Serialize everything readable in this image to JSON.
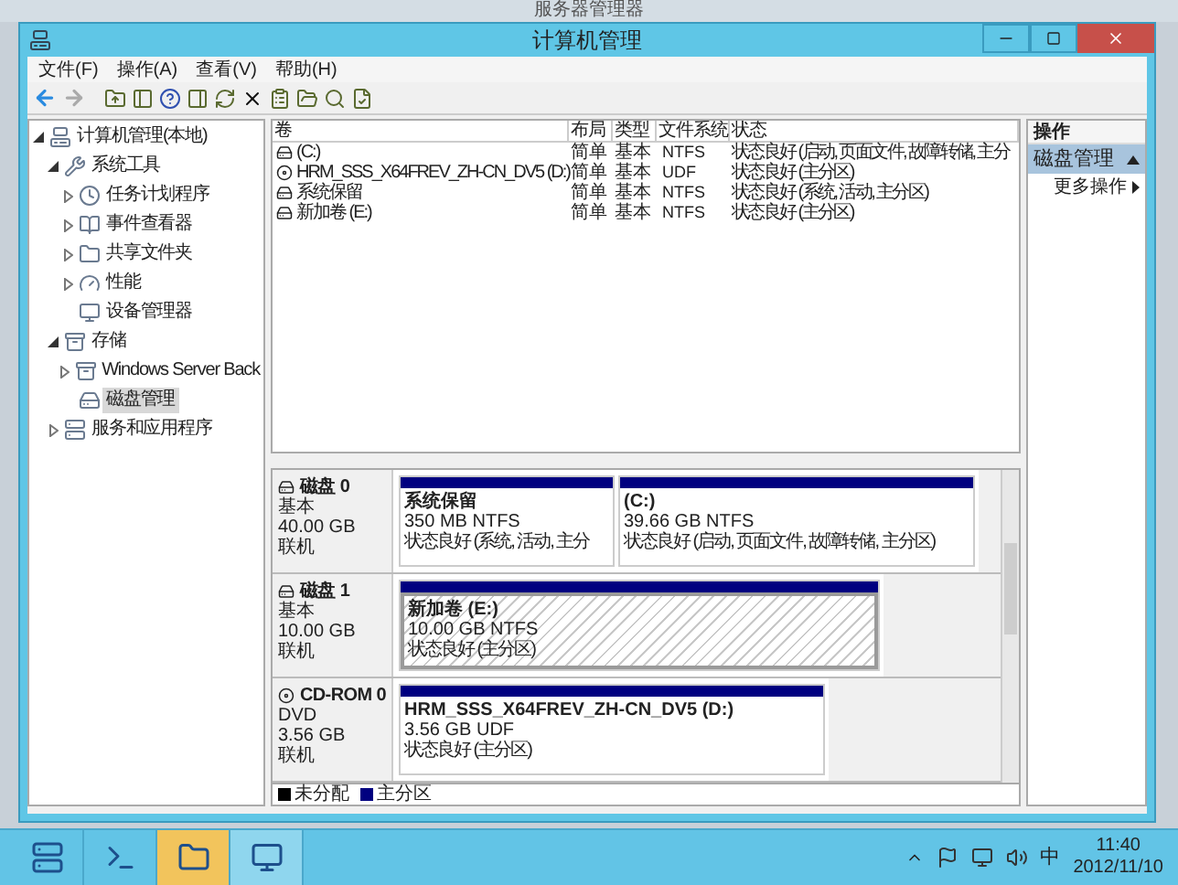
{
  "background_window": {
    "title": "服务器管理器"
  },
  "window": {
    "title": "计算机管理"
  },
  "menu": [
    {
      "label": "文件(F)"
    },
    {
      "label": "操作(A)"
    },
    {
      "label": "查看(V)"
    },
    {
      "label": "帮助(H)"
    }
  ],
  "toolbar": {
    "back_disabled": false,
    "forward_disabled": true
  },
  "tree": [
    {
      "label": "计算机管理(本地)",
      "expanded": true,
      "selected": false,
      "children": [
        {
          "label": "系统工具",
          "expanded": true,
          "selected": false,
          "children": [
            {
              "label": "任务计划程序",
              "expanded": false,
              "selected": false
            },
            {
              "label": "事件查看器",
              "expanded": false,
              "selected": false
            },
            {
              "label": "共享文件夹",
              "expanded": false,
              "selected": false
            },
            {
              "label": "性能",
              "expanded": false,
              "selected": false
            },
            {
              "label": "设备管理器",
              "selected": false
            }
          ]
        },
        {
          "label": "存储",
          "expanded": true,
          "selected": false,
          "children": [
            {
              "label": "Windows Server Back",
              "expanded": false,
              "selected": false
            },
            {
              "label": "磁盘管理",
              "selected": true
            }
          ]
        },
        {
          "label": "服务和应用程序",
          "expanded": false,
          "selected": false
        }
      ]
    }
  ],
  "table": {
    "columns": [
      "卷",
      "布局",
      "类型",
      "文件系统",
      "状态"
    ],
    "rows": [
      {
        "volume": "(C:)",
        "layout": "简单",
        "type": "基本",
        "fs": "NTFS",
        "status": "状态良好 (启动, 页面文件, 故障转储, 主分"
      },
      {
        "volume": "HRM_SSS_X64FREV_ZH-CN_DV5 (D:)",
        "layout": "简单",
        "type": "基本",
        "fs": "UDF",
        "status": "状态良好 (主分区)"
      },
      {
        "volume": "系统保留",
        "layout": "简单",
        "type": "基本",
        "fs": "NTFS",
        "status": "状态良好 (系统, 活动, 主分区)"
      },
      {
        "volume": "新加卷 (E:)",
        "layout": "简单",
        "type": "基本",
        "fs": "NTFS",
        "status": "状态良好 (主分区)"
      }
    ]
  },
  "disks": [
    {
      "name": "磁盘 0",
      "kind": "disk",
      "type": "基本",
      "size": "40.00 GB",
      "state": "联机",
      "partitions": [
        {
          "name": "系统保留",
          "size": "350 MB NTFS",
          "status": "状态良好 (系统, 活动, 主分",
          "selected": false
        },
        {
          "name": "(C:)",
          "size": "39.66 GB NTFS",
          "status": "状态良好 (启动, 页面文件, 故障转储, 主分区)",
          "selected": false
        }
      ]
    },
    {
      "name": "磁盘 1",
      "kind": "disk",
      "type": "基本",
      "size": "10.00 GB",
      "state": "联机",
      "partitions": [
        {
          "name": "新加卷  (E:)",
          "size": "10.00 GB NTFS",
          "status": "状态良好 (主分区)",
          "selected": true
        }
      ]
    },
    {
      "name": "CD-ROM 0",
      "kind": "cdrom",
      "type": "DVD",
      "size": "3.56 GB",
      "state": "联机",
      "partitions": [
        {
          "name": "HRM_SSS_X64FREV_ZH-CN_DV5  (D:)",
          "size": "3.56 GB UDF",
          "status": "状态良好 (主分区)",
          "selected": false
        }
      ]
    }
  ],
  "legend": [
    {
      "label": "未分配",
      "color": "#000000"
    },
    {
      "label": "主分区",
      "color": "#000080"
    }
  ],
  "actions": {
    "header": "操作",
    "section": {
      "title": "磁盘管理",
      "expanded": true
    },
    "items": [
      {
        "label": "更多操作"
      }
    ]
  },
  "taskbar": {
    "apps": [
      {
        "selected": false
      },
      {
        "selected": false
      },
      {
        "selected": true
      },
      {
        "selected": false
      }
    ],
    "ime": "中",
    "time": "11:40",
    "date": "2012/11/10"
  }
}
